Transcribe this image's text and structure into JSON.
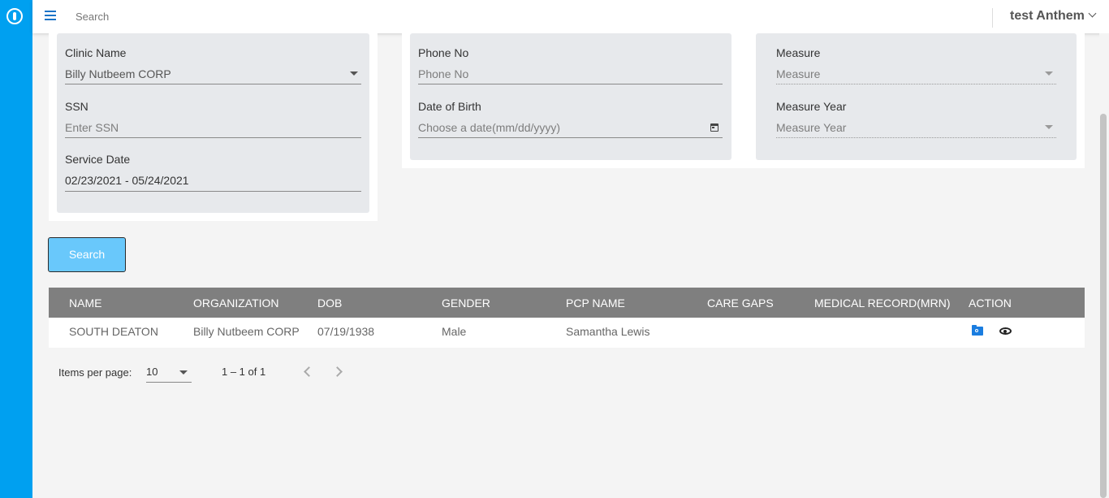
{
  "topbar": {
    "search_placeholder": "Search",
    "user_name": "test Anthem"
  },
  "form": {
    "clinic_name": {
      "label": "Clinic Name",
      "value": "Billy Nutbeem CORP"
    },
    "ssn": {
      "label": "SSN",
      "placeholder": "Enter SSN"
    },
    "service_date": {
      "label": "Service Date",
      "value": "02/23/2021 - 05/24/2021"
    },
    "phone_no": {
      "label": "Phone No",
      "placeholder": "Phone No"
    },
    "date_of_birth": {
      "label": "Date of Birth",
      "placeholder": "Choose a date(mm/dd/yyyy)"
    },
    "measure": {
      "label": "Measure",
      "placeholder": "Measure"
    },
    "measure_year": {
      "label": "Measure Year",
      "placeholder": "Measure Year"
    }
  },
  "search_button": "Search",
  "table": {
    "headers": [
      "NAME",
      "ORGANIZATION",
      "DOB",
      "GENDER",
      "PCP NAME",
      "CARE GAPS",
      "MEDICAL RECORD(MRN)",
      "ACTION"
    ],
    "rows": [
      {
        "name": "SOUTH DEATON",
        "organization": "Billy Nutbeem CORP",
        "dob": "07/19/1938",
        "gender": "Male",
        "pcp_name": "Samantha Lewis",
        "care_gaps": "",
        "mrn": ""
      }
    ],
    "action_icons": [
      "folder-search-icon",
      "eye-icon"
    ]
  },
  "paginator": {
    "items_per_page_label": "Items per page:",
    "page_size": "10",
    "range_label": "1 – 1 of 1"
  },
  "colors": {
    "sidebar": "#00a0f0",
    "accent": "#1a73c7",
    "search_button": "#69c8fb",
    "table_header": "#7f7f7f",
    "panel": "#e7e9ec"
  }
}
